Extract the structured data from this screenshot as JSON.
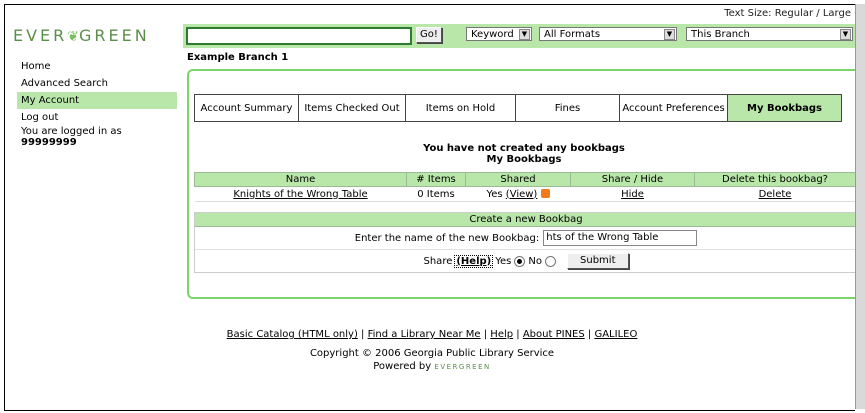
{
  "header": {
    "text_size_label": "Text Size:",
    "text_size_regular": "Regular",
    "text_size_sep": "/",
    "text_size_large": "Large",
    "logo_left": "EVER",
    "logo_right": "GREEN"
  },
  "search": {
    "query": "",
    "go_label": "Go!",
    "type_value": "Keyword",
    "format_value": "All Formats",
    "scope_value": "This Branch"
  },
  "sidebar": {
    "items": [
      {
        "label": "Home"
      },
      {
        "label": "Advanced Search"
      },
      {
        "label": "My Account"
      },
      {
        "label": "Log out"
      }
    ],
    "logged_in_label": "You are logged in as",
    "username": "99999999"
  },
  "branch_name": "Example Branch 1",
  "tabs": [
    {
      "label": "Account Summary"
    },
    {
      "label": "Items Checked Out"
    },
    {
      "label": "Items on Hold"
    },
    {
      "label": "Fines"
    },
    {
      "label": "Account Preferences"
    },
    {
      "label": "My Bookbags"
    }
  ],
  "notice": {
    "line1": "You have not created any bookbags",
    "line2": "My Bookbags"
  },
  "table": {
    "headers": [
      "Name",
      "# Items",
      "Shared",
      "Share / Hide",
      "Delete this bookbag?"
    ],
    "rows": [
      {
        "name": "Knights of the Wrong Table",
        "items": "0 Items",
        "shared_yes": "Yes",
        "shared_view": "(View)",
        "action": "Hide",
        "delete": "Delete"
      }
    ]
  },
  "create": {
    "title": "Create a new Bookbag",
    "name_label": "Enter the name of the new Bookbag:",
    "name_value": "hts of the Wrong Table",
    "share_label": "Share",
    "help_label": "(Help)",
    "yes_label": "Yes",
    "no_label": "No",
    "submit_label": "Submit"
  },
  "footer": {
    "links": [
      "Basic Catalog (HTML only)",
      "Find a Library Near Me",
      "Help",
      "About PINES",
      "GALILEO"
    ],
    "copyright": "Copyright © 2006 Georgia Public Library Service",
    "powered_by": "Powered by",
    "powered_logo": "EVERGREEN"
  },
  "colors": {
    "accent_green": "#b9e7a9",
    "border_green": "#7cd46a",
    "rss_orange": "#f27a1a"
  }
}
